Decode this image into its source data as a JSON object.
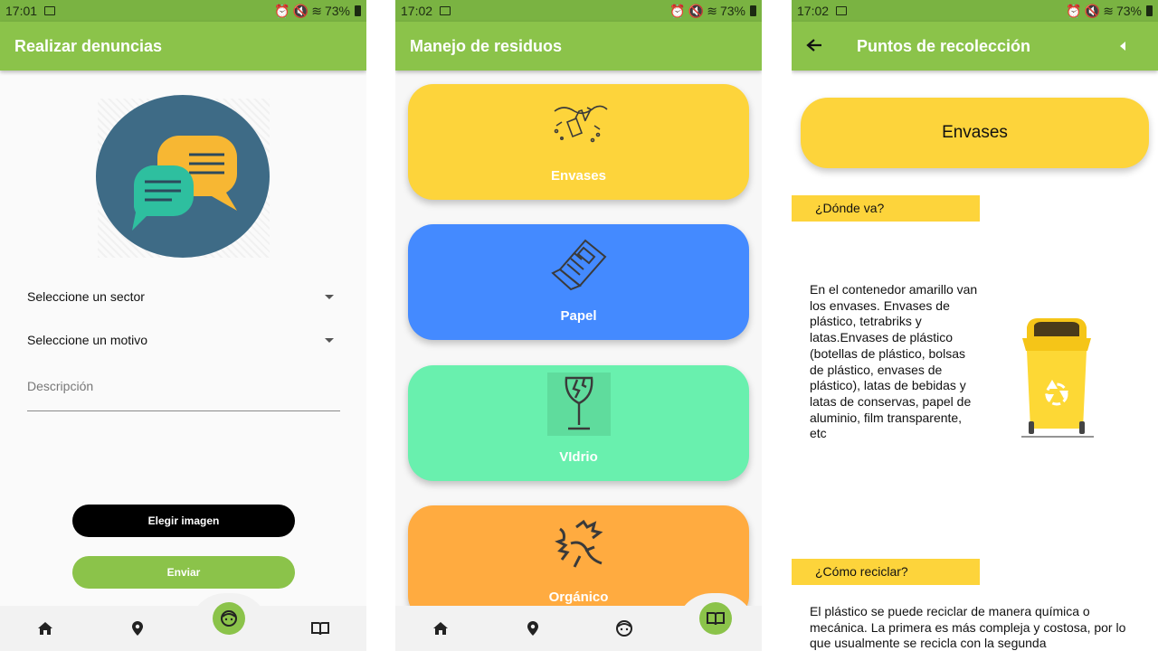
{
  "status_bars": [
    {
      "time": "17:01",
      "battery": "73%"
    },
    {
      "time": "17:02",
      "battery": "73%"
    },
    {
      "time": "17:02",
      "battery": "73%"
    }
  ],
  "screen1": {
    "title": "Realizar denuncias",
    "sector_placeholder": "Seleccione un sector",
    "motivo_placeholder": "Seleccione un motivo",
    "descripcion_placeholder": "Descripción",
    "choose_image_label": "Elegir imagen",
    "send_label": "Enviar"
  },
  "screen2": {
    "title": "Manejo de residuos",
    "cards": [
      {
        "label": "Envases",
        "color": "#fdd43b",
        "icon": "bottles-icon"
      },
      {
        "label": "Papel",
        "color": "#448aff",
        "icon": "newspaper-icon"
      },
      {
        "label": "VIdrio",
        "color": "#69f0ae",
        "icon": "broken-glass-icon"
      },
      {
        "label": "Orgánico",
        "color": "#ffab40",
        "icon": "fishbone-icon"
      }
    ]
  },
  "screen3": {
    "title": "Puntos de recolección",
    "category": "Envases",
    "where_label": "¿Dónde va?",
    "where_text": "En el contenedor amarillo van los envases. Envases de plástico, tetrabriks y latas.Envases de plástico (botellas de plástico, bolsas de plástico, envases de plástico), latas de bebidas y latas de conservas, papel de aluminio, film transparente, etc",
    "how_label": "¿Cómo reciclar?",
    "how_text": "El plástico se puede reciclar de manera química o mecánica. La primera es más compleja y costosa, por lo que usualmente se recicla con la segunda"
  },
  "colors": {
    "appbar": "#8bc34a",
    "statusbar": "#7ab342",
    "yellow": "#fdd43b",
    "blue": "#448aff",
    "mint": "#69f0ae",
    "orange": "#ffab40"
  }
}
